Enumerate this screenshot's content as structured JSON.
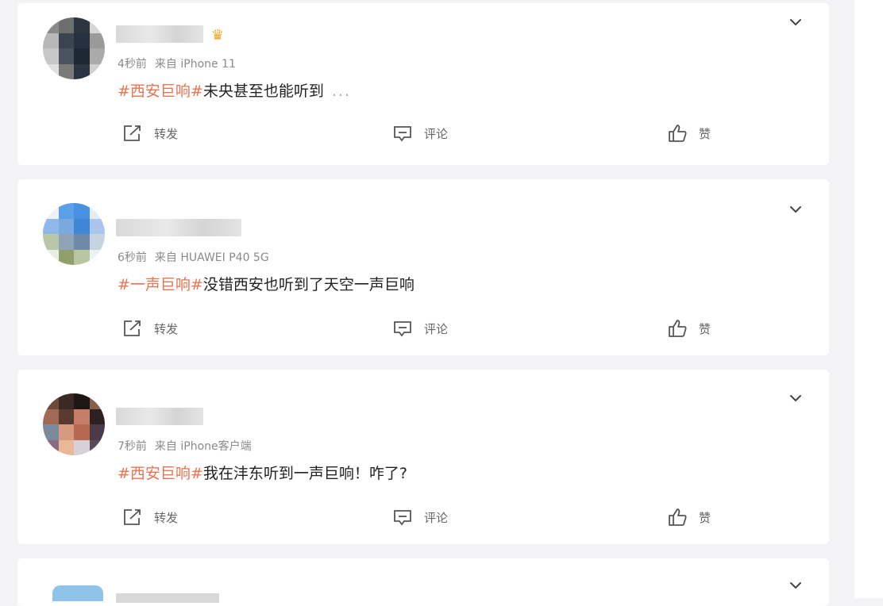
{
  "posts": [
    {
      "time": "4秒前",
      "source": "来自 iPhone 11",
      "topic": "#西安巨响#",
      "text": "未央甚至也能听到",
      "more": "...",
      "actions": {
        "repost": "转发",
        "comment": "评论",
        "like": "赞"
      }
    },
    {
      "time": "6秒前",
      "source": "来自 HUAWEI P40 5G",
      "topic": "#一声巨响#",
      "text": "没错西安也听到了天空一声巨响",
      "actions": {
        "repost": "转发",
        "comment": "评论",
        "like": "赞"
      }
    },
    {
      "time": "7秒前",
      "source": "来自 iPhone客户端",
      "topic": "#西安巨响#",
      "text": "我在沣东听到一声巨响！咋了?",
      "actions": {
        "repost": "转发",
        "comment": "评论",
        "like": "赞"
      }
    }
  ],
  "icons": {
    "vip": "crown-icon",
    "menu": "chevron-down-icon",
    "repost": "repost-icon",
    "comment": "comment-icon",
    "like": "like-icon"
  },
  "colors": {
    "topic": "#eb7350",
    "background": "#f3f3f5",
    "card": "#ffffff"
  }
}
